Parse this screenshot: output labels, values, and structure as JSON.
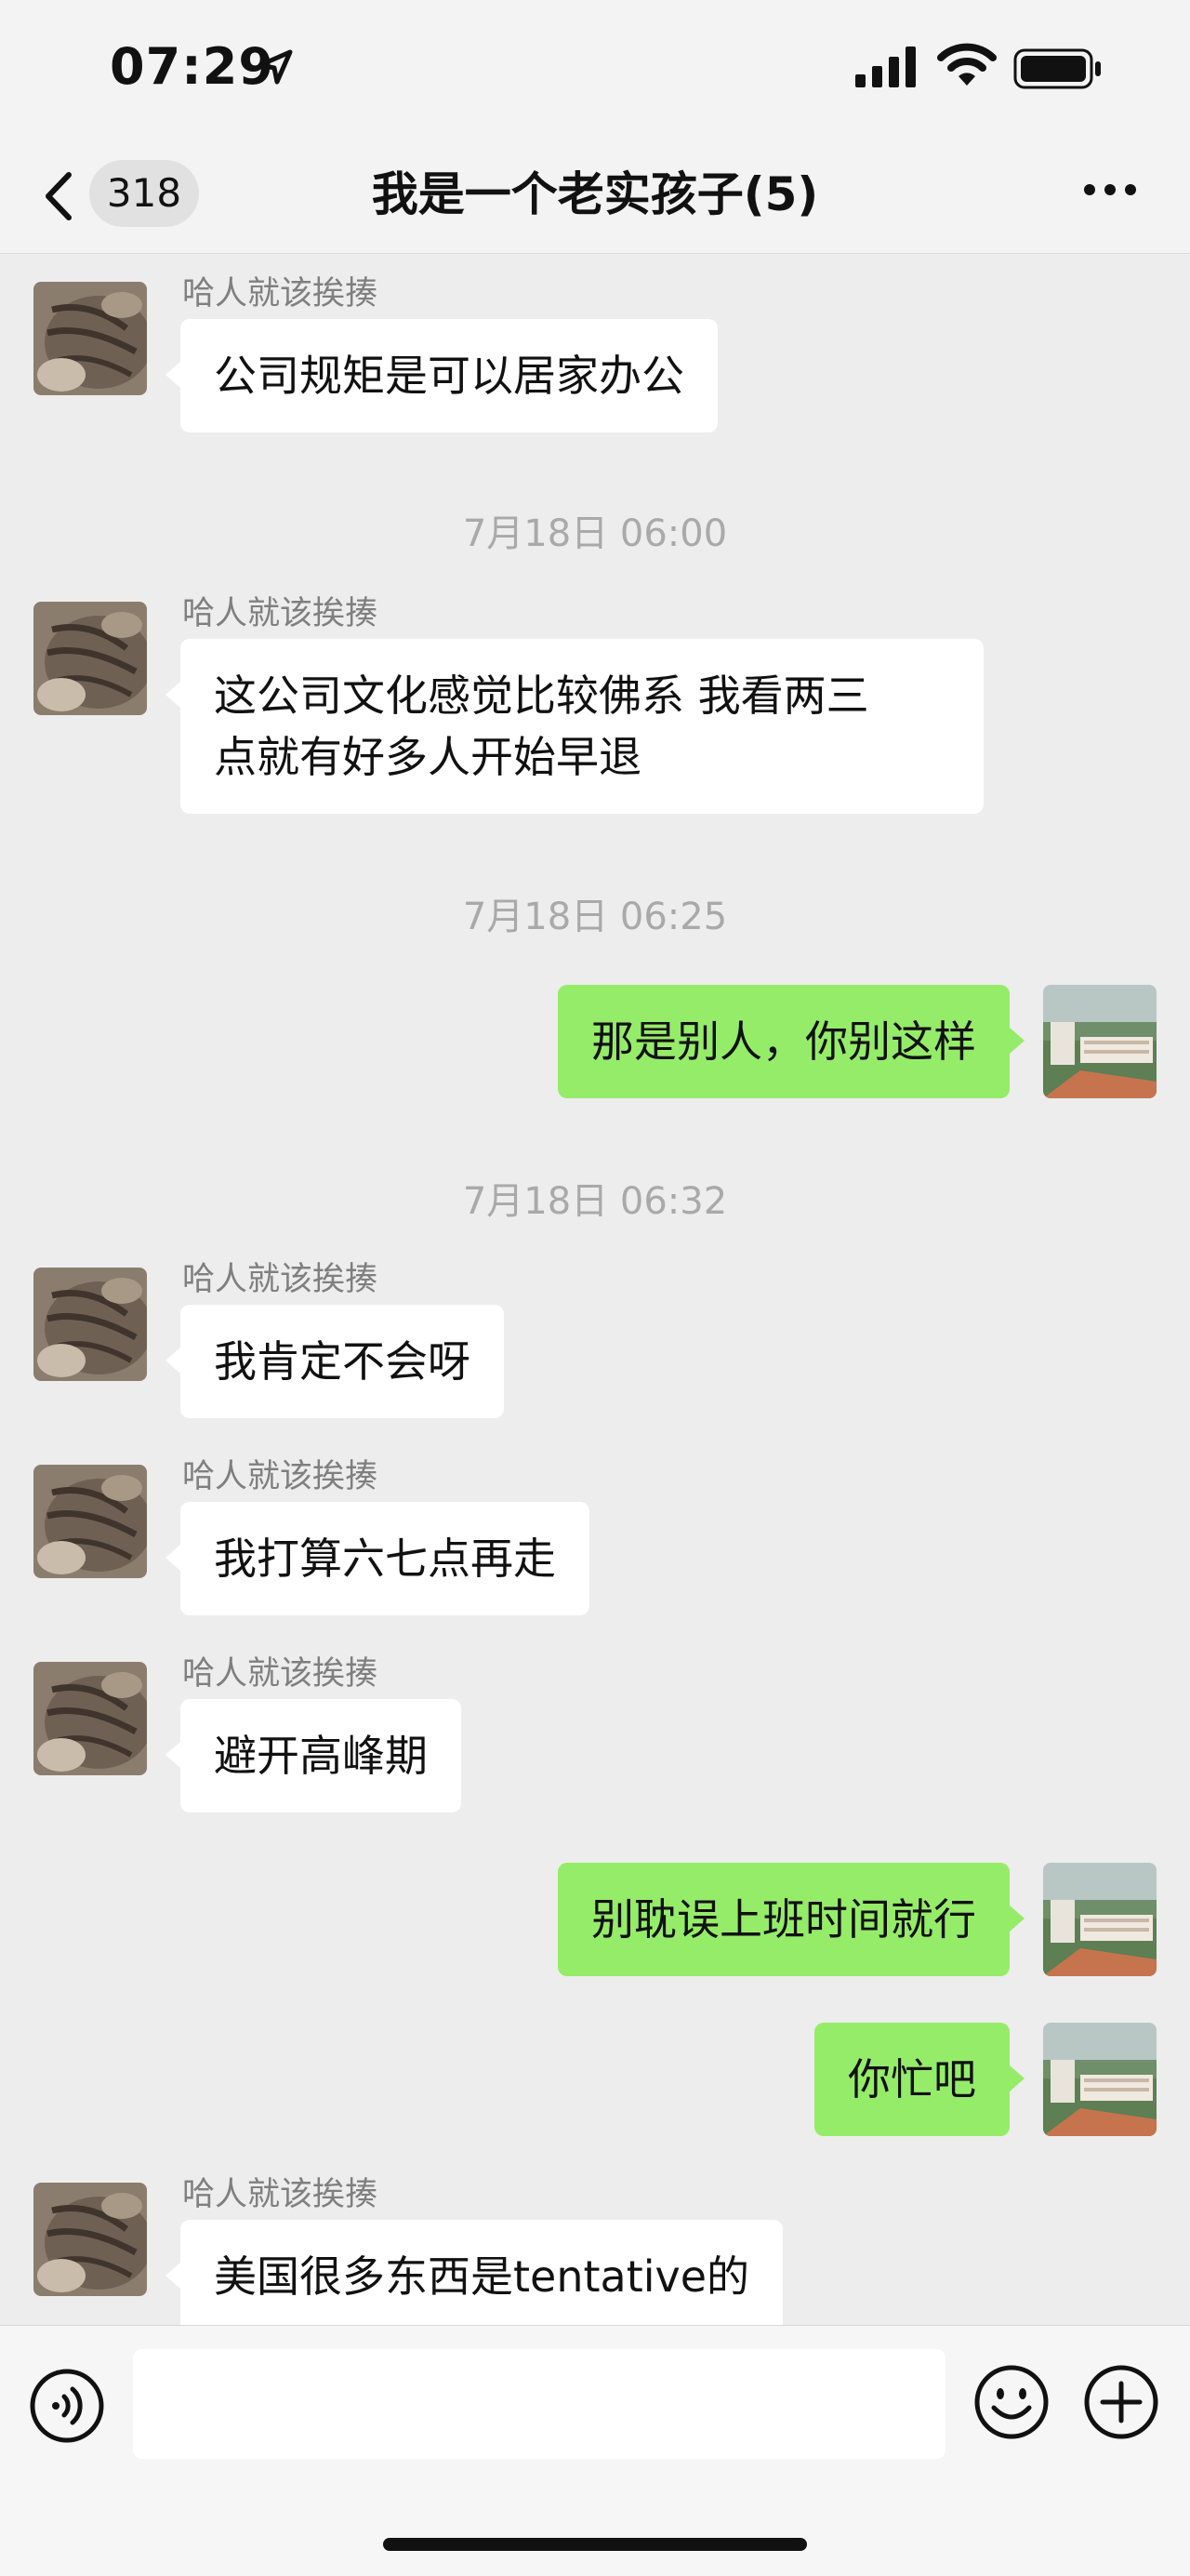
{
  "status_bar": {
    "time": "07:29",
    "icons": [
      "location-arrow-icon",
      "signal-icon",
      "wifi-icon",
      "battery-icon"
    ]
  },
  "nav": {
    "back_icon": "chevron-left-icon",
    "unread_count": "318",
    "title": "我是一个老实孩子(5)",
    "more_icon": "more-icon"
  },
  "messages": [
    {
      "type": "received",
      "sender": "哈人就该挨揍",
      "lines": [
        "公司规矩是可以居家办公"
      ]
    },
    {
      "type": "timestamp",
      "text": "7月18日 06:00"
    },
    {
      "type": "received",
      "sender": "哈人就该挨揍",
      "lines": [
        "这公司文化感觉比较佛系 我看两三",
        "点就有好多人开始早退"
      ]
    },
    {
      "type": "timestamp",
      "text": "7月18日 06:25"
    },
    {
      "type": "sent",
      "lines": [
        "那是别人，你别这样"
      ]
    },
    {
      "type": "timestamp",
      "text": "7月18日 06:32"
    },
    {
      "type": "received",
      "sender": "哈人就该挨揍",
      "lines": [
        "我肯定不会呀"
      ]
    },
    {
      "type": "received",
      "sender": "哈人就该挨揍",
      "lines": [
        "我打算六七点再走"
      ]
    },
    {
      "type": "received",
      "sender": "哈人就该挨揍",
      "lines": [
        "避开高峰期"
      ]
    },
    {
      "type": "sent",
      "lines": [
        "别耽误上班时间就行"
      ]
    },
    {
      "type": "sent",
      "lines": [
        "你忙吧"
      ]
    },
    {
      "type": "received",
      "sender": "哈人就该挨揍",
      "lines": [
        "美国很多东西是tentative的"
      ]
    }
  ],
  "input_bar": {
    "left_icon": "voice-icon",
    "text_value": "",
    "right_icons": [
      "emoji-icon",
      "plus-icon"
    ]
  },
  "colors": {
    "background": "#ededed",
    "sent_bubble": "#95ec69",
    "received_bubble": "#ffffff",
    "timestamp_text": "#a9a9a9",
    "sender_text": "#7f7f7f"
  }
}
